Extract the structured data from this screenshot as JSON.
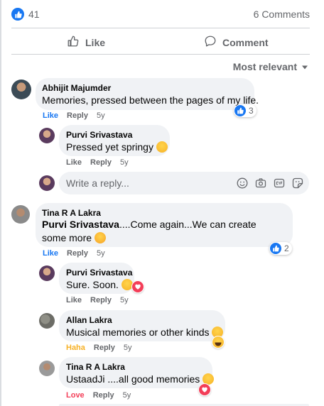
{
  "summary": {
    "likes_count": "41",
    "comments_count": "6 Comments"
  },
  "actions": {
    "like_label": "Like",
    "comment_label": "Comment"
  },
  "sort": {
    "label": "Most relevant"
  },
  "comments": [
    {
      "author": "Abhijit Majumder",
      "text": "Memories, pressed between the pages of my life.",
      "like": "Like",
      "reply": "Reply",
      "age": "5y",
      "reaction_count": "3"
    },
    {
      "author": "Purvi Srivastava",
      "text": "Pressed yet springy",
      "like": "Like",
      "reply": "Reply",
      "age": "5y"
    },
    {
      "author": "Tina R A Lakra",
      "mention": "Purvi Srivastava",
      "text": "....Come again...We can create some more",
      "like": "Like",
      "reply": "Reply",
      "age": "5y",
      "reaction_count": "2"
    },
    {
      "author": "Purvi Srivastava",
      "text": "Sure. Soon.",
      "like": "Like",
      "reply": "Reply",
      "age": "5y"
    },
    {
      "author": "Allan Lakra",
      "text": "Musical memories or other kinds",
      "like": "Haha",
      "reply": "Reply",
      "age": "5y"
    },
    {
      "author": "Tina R A Lakra",
      "text": "UstaadJi ....all good memories",
      "like": "Love",
      "reply": "Reply",
      "age": "5y"
    }
  ],
  "reply_box": {
    "placeholder": "Write a reply..."
  },
  "colors": {
    "brand_blue": "#1877f2",
    "haha": "#f7b125",
    "love": "#f33e58",
    "bubble": "#f0f2f5"
  },
  "icons": [
    "like-thumb-icon",
    "comment-icon",
    "chevron-down-icon",
    "emoji-icon",
    "camera-icon",
    "gif-icon",
    "sticker-icon"
  ]
}
